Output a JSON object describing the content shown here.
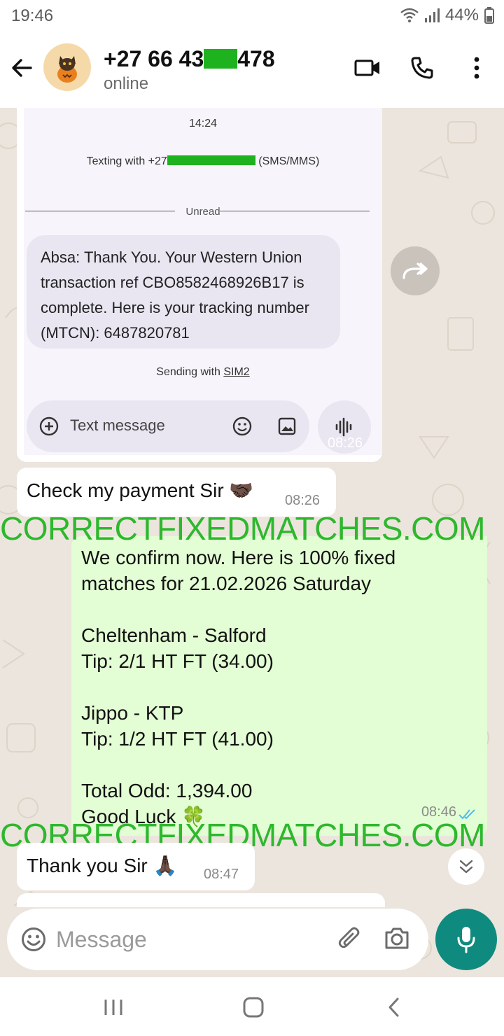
{
  "status_bar": {
    "time": "19:46",
    "battery": "44%"
  },
  "header": {
    "contact_prefix": "+27 66 43",
    "contact_suffix": "478",
    "status": "online"
  },
  "screenshot": {
    "time": "14:24",
    "texting_prefix": "Texting with +27",
    "texting_suffix": "(SMS/MMS)",
    "unread": "Unread",
    "message": "Absa: Thank You. Your Western Union transaction ref CBO8582468926B17 is complete. Here is your tracking number (MTCN): 6487820781",
    "sending_prefix": "Sending with ",
    "sending_sim": "SIM2",
    "compose_placeholder": "Text message",
    "timestamp": "08:26"
  },
  "messages": {
    "check": {
      "text": "Check my payment Sir 🤝🏿",
      "time": "08:26"
    },
    "tips": {
      "text": "We confirm now. Here is 100% fixed\nmatches for 21.02.2026 Saturday\n\nCheltenham - Salford\nTip: 2/1 HT FT (34.00)\n\nJippo - KTP\nTip: 1/2 HT FT (41.00)\n\nTotal Odd: 1,394.00\nGood Luck 🍀",
      "time": "08:46"
    },
    "thanks": {
      "text": "Thank you Sir 🙏🏿",
      "time": "08:47"
    }
  },
  "watermark": "CORRECTFIXEDMATCHES.COM",
  "input": {
    "placeholder": "Message"
  },
  "colors": {
    "accent": "#0f8a7e",
    "outgoing": "#e3fdd4",
    "watermark": "#2db82d",
    "redaction": "#1fb21f"
  }
}
